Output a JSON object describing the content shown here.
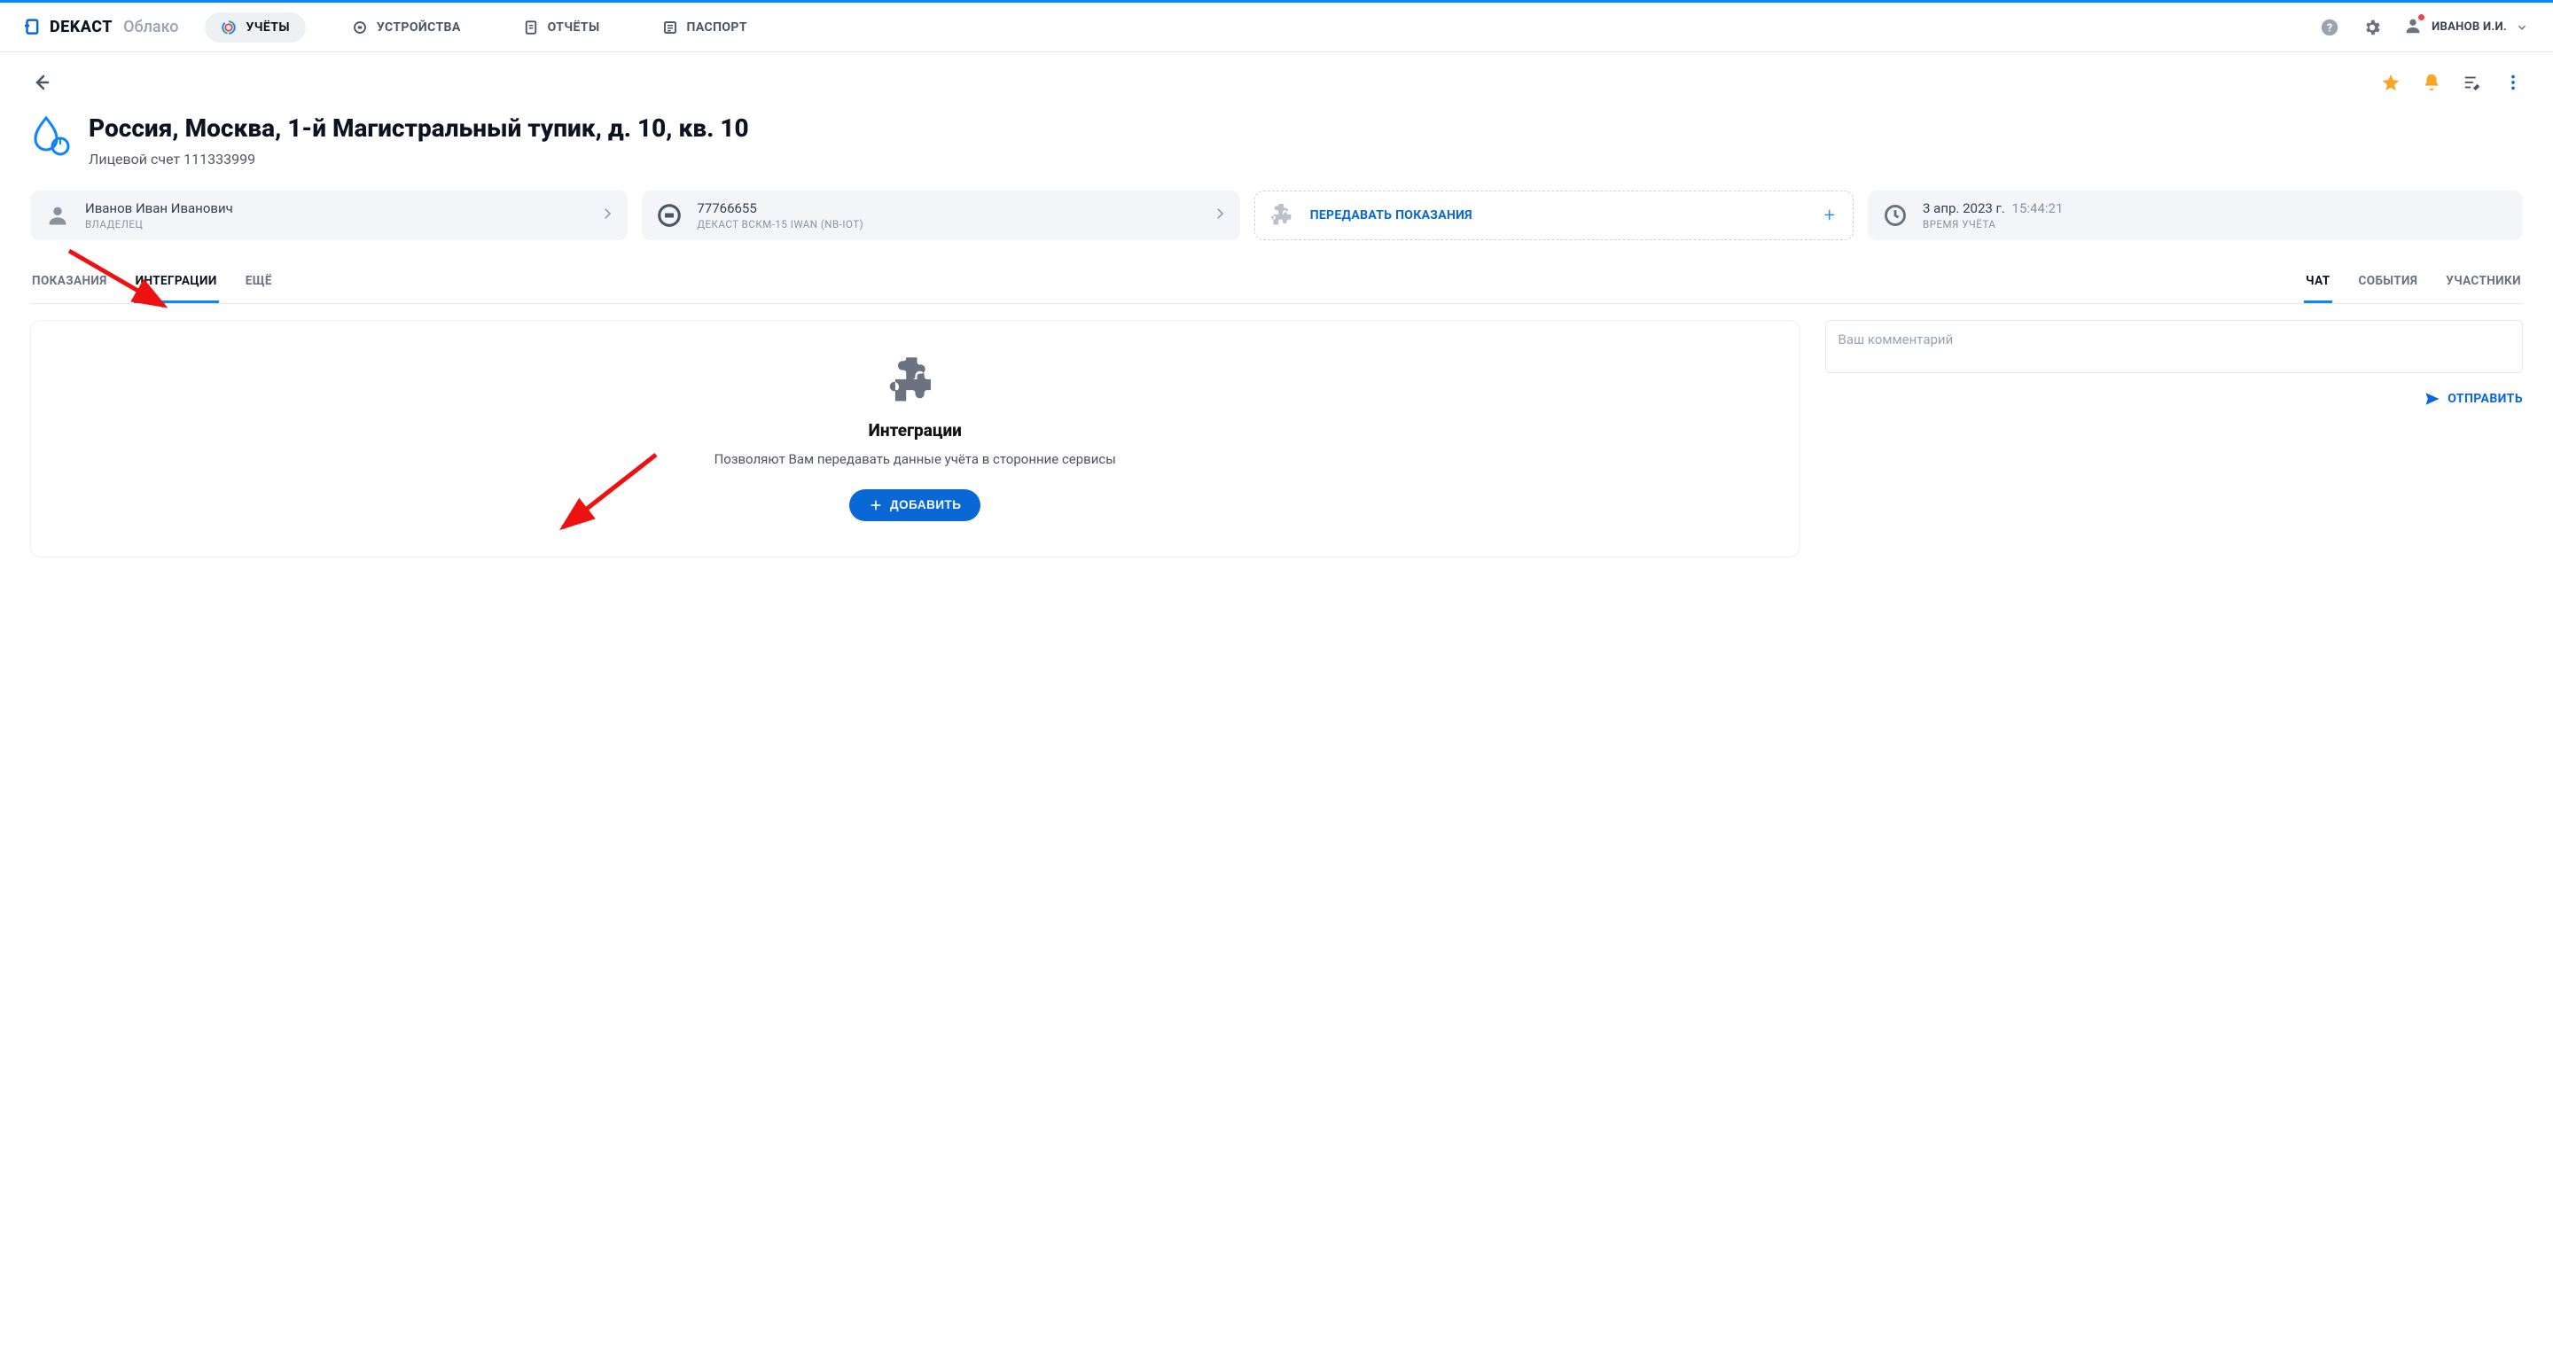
{
  "brand": {
    "name": "DEKACT",
    "sub": "Облако"
  },
  "nav": {
    "accounts": "УЧЁТЫ",
    "devices": "УСТРОЙСТВА",
    "reports": "ОТЧЁТЫ",
    "passport": "ПАСПОРТ"
  },
  "user": {
    "name": "ИВАНОВ И.И."
  },
  "page": {
    "title": "Россия, Москва, 1-й Магистральный тупик, д. 10, кв. 10",
    "subtitle": "Лицевой счет 111333999"
  },
  "cards": {
    "owner": {
      "name": "Иванов Иван Иванович",
      "role": "ВЛАДЕЛЕЦ"
    },
    "device": {
      "serial": "77766655",
      "model": "ДЕКАСТ ВСКМ-15 IWAN (NB-IOT)"
    },
    "transfer": {
      "label": "ПЕРЕДАВАТЬ ПОКАЗАНИЯ"
    },
    "time": {
      "date": "3 апр. 2023 г.",
      "time": "15:44:21",
      "label": "ВРЕМЯ УЧЁТА"
    }
  },
  "tabs_left": {
    "readings": "ПОКАЗАНИЯ",
    "integrations": "ИНТЕГРАЦИИ",
    "more": "ЕЩЁ"
  },
  "tabs_right": {
    "chat": "ЧАТ",
    "events": "СОБЫТИЯ",
    "participants": "УЧАСТНИКИ"
  },
  "panel": {
    "title": "Интеграции",
    "desc": "Позволяют Вам передавать данные учёта в сторонние сервисы",
    "add": "ДОБАВИТЬ"
  },
  "chat": {
    "placeholder": "Ваш комментарий",
    "send": "ОТПРАВИТЬ"
  }
}
